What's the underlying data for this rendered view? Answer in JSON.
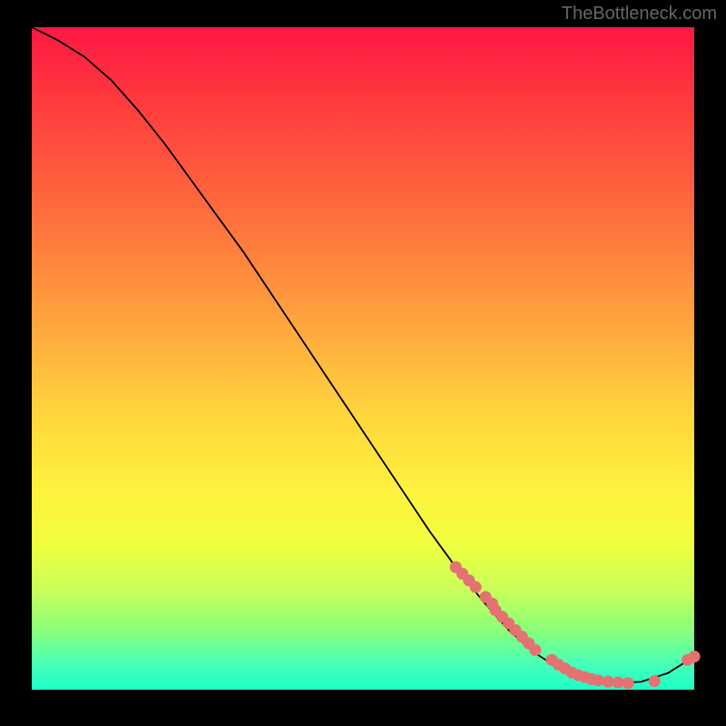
{
  "watermark": "TheBottleneck.com",
  "chart_data": {
    "type": "line",
    "title": "",
    "xlabel": "",
    "ylabel": "",
    "xlim": [
      0,
      100
    ],
    "ylim": [
      0,
      100
    ],
    "series": [
      {
        "name": "curve",
        "x": [
          0,
          4,
          8,
          12,
          16,
          20,
          24,
          28,
          32,
          36,
          40,
          44,
          48,
          52,
          56,
          60,
          64,
          68,
          72,
          76,
          80,
          84,
          88,
          92,
          96,
          100
        ],
        "y": [
          100,
          98,
          95.5,
          92,
          87.5,
          82.5,
          77,
          71.5,
          66,
          60,
          54,
          48,
          42,
          36,
          30,
          24,
          18.5,
          13.5,
          9,
          5.5,
          3,
          1.5,
          1,
          1.2,
          2.5,
          5
        ]
      }
    ],
    "markers": {
      "name": "points",
      "x": [
        64,
        65,
        66,
        67,
        68.5,
        69.5,
        70,
        71,
        72,
        73,
        74,
        75,
        76,
        78.5,
        79.5,
        80.5,
        81.5,
        82.5,
        83.5,
        84.5,
        85.5,
        87,
        88.5,
        90,
        94,
        99,
        100
      ],
      "y": [
        18.5,
        17.5,
        16.5,
        15.5,
        14,
        13,
        12,
        11,
        10,
        9,
        8,
        7,
        6,
        4.5,
        3.8,
        3.2,
        2.6,
        2.2,
        1.9,
        1.6,
        1.4,
        1.2,
        1.1,
        1,
        1.3,
        4.5,
        5
      ]
    },
    "colors": {
      "line": "#000000",
      "marker": "#e57272"
    }
  }
}
